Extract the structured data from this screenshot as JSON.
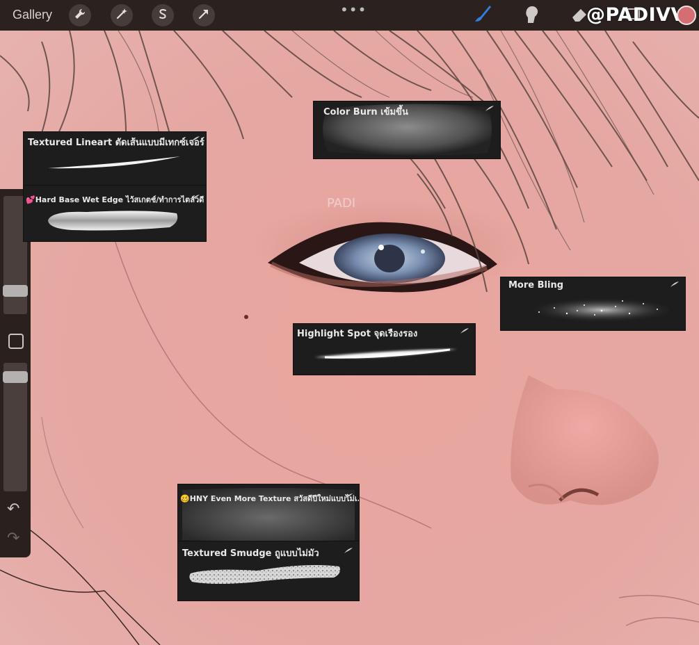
{
  "toolbar": {
    "gallery_label": "Gallery",
    "more_label": "•••",
    "tools_left": [
      "wrench-icon",
      "magic-wand-icon",
      "selection-s-icon",
      "arrow-transform-icon"
    ],
    "tools_right": [
      "brush-icon",
      "smudge-icon",
      "eraser-icon",
      "layers-icon"
    ],
    "accent_color": "#2f7fe5",
    "current_color": "#d46e73"
  },
  "watermark": "@PADIVV",
  "canvas": {
    "signature": "PADI"
  },
  "sidebar": {
    "undo_label": "↶",
    "redo_label": "↷"
  },
  "brushes": [
    {
      "name": "Textured Lineart ตัดเส้นแบบมีเทกซ์เจอร์"
    },
    {
      "name": "💕Hard Base Wet Edge ไว้สเกตช์/ทำการไตล์วดี"
    },
    {
      "name": "Color Burn เข้มขึ้น"
    },
    {
      "name": "More Bling"
    },
    {
      "name": "Highlight Spot จุดเรืองรอง"
    },
    {
      "name": "🥴HNY Even More Texture สวัสดีปีใหม่แบบไม่เ..."
    },
    {
      "name": "Textured Smudge ถูแบบไม่มัว"
    }
  ]
}
